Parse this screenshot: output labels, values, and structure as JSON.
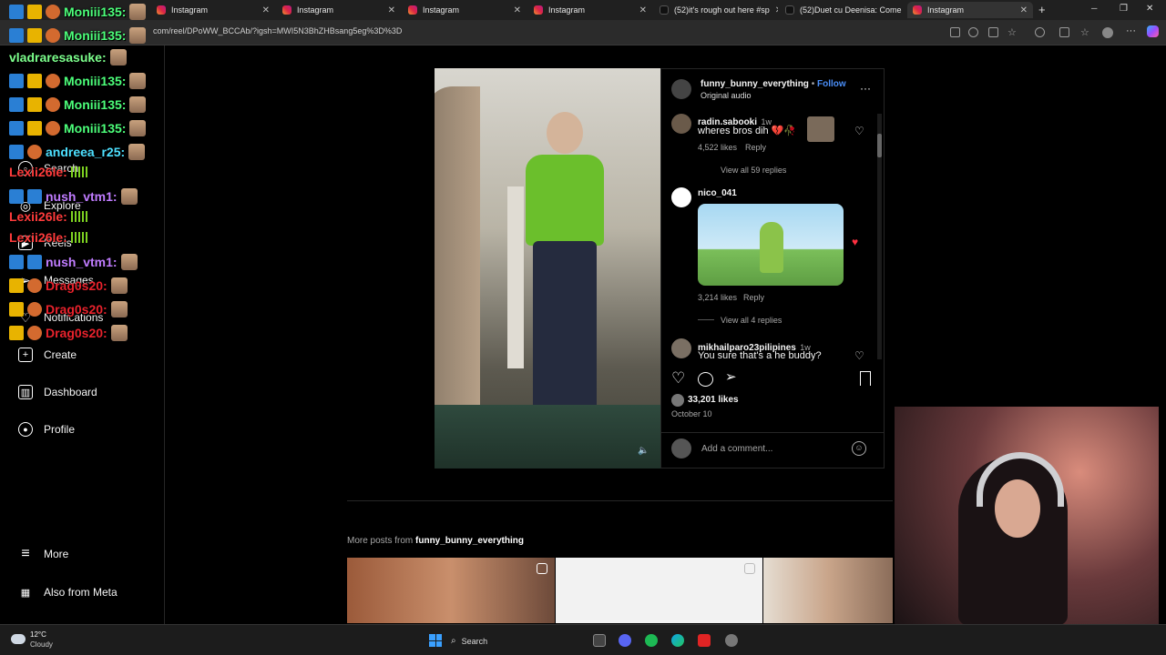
{
  "browser": {
    "tabs": [
      {
        "title": "Instagram",
        "icon": "instagram-icon"
      },
      {
        "title": "Instagram",
        "icon": "instagram-icon"
      },
      {
        "title": "Instagram",
        "icon": "instagram-icon"
      },
      {
        "title": "Instagram",
        "icon": "instagram-icon"
      },
      {
        "title": "(52)it's rough out here #sp",
        "icon": "tiktok-icon"
      },
      {
        "title": "(52)Duet cu Deenisa: Come",
        "icon": "tiktok-icon"
      },
      {
        "title": "Instagram",
        "icon": "instagram-icon"
      }
    ],
    "url": "com/reel/DPoWW_BCCAb/?igsh=MWI5N3BhZHBsang5eg%3D%3D",
    "new_tab": "+",
    "minimize": "─",
    "restore": "❐",
    "close": "✕"
  },
  "sidebar": {
    "items": [
      {
        "label": "Search",
        "icon": "search-icon"
      },
      {
        "label": "Explore",
        "icon": "compass-icon"
      },
      {
        "label": "Reels",
        "icon": "reels-icon"
      },
      {
        "label": "Messages",
        "icon": "messages-icon"
      },
      {
        "label": "Notifications",
        "icon": "heart-icon"
      },
      {
        "label": "Create",
        "icon": "plus-icon"
      },
      {
        "label": "Dashboard",
        "icon": "chart-icon"
      },
      {
        "label": "Profile",
        "icon": "profile-icon"
      }
    ],
    "more": "More",
    "meta": "Also from Meta"
  },
  "chat": [
    {
      "user": "Moniii135:",
      "color": "#4cff7a"
    },
    {
      "user": "Moniii135:",
      "color": "#4cff7a"
    },
    {
      "user": "vladraresasuke:",
      "color": "#7cff8c"
    },
    {
      "user": "Moniii135:",
      "color": "#4cff7a"
    },
    {
      "user": "Moniii135:",
      "color": "#4cff7a"
    },
    {
      "user": "Moniii135:",
      "color": "#4cff7a"
    },
    {
      "user": "andreea_r25:",
      "color": "#4de0ff"
    },
    {
      "user": "Lexii26le:",
      "color": "#ff3b3b"
    },
    {
      "user": "nush_vtm1:",
      "color": "#c07cff"
    },
    {
      "user": "Lexii26le:",
      "color": "#ff3b3b"
    },
    {
      "user": "Lexii26le:",
      "color": "#ff3b3b"
    },
    {
      "user": "nush_vtm1:",
      "color": "#c07cff"
    },
    {
      "user": "Drag0s20:",
      "color": "#e8222c"
    },
    {
      "user": "Drag0s20:",
      "color": "#e8222c"
    },
    {
      "user": "Drag0s20:",
      "color": "#e8222c"
    }
  ],
  "post": {
    "author": "funny_bunny_everything",
    "dot": "•",
    "follow": "Follow",
    "audio": "Original audio",
    "more": "···",
    "comments": [
      {
        "user": "radin.sabooki",
        "age": "1w",
        "text": "wheres bros dih 💔🥀",
        "likes": "4,522 likes",
        "reply": "Reply",
        "view": "View all 59 replies"
      },
      {
        "user": "nico_041",
        "age": "",
        "text": "",
        "likes": "3,214 likes",
        "reply": "Reply",
        "view": "View all 4 replies"
      },
      {
        "user": "mikhailparo23pilipines",
        "age": "1w",
        "text": "You sure that's a he buddy?"
      }
    ],
    "likes": "33,201 likes",
    "date": "October 10",
    "add_comment": "Add a comment..."
  },
  "more_posts": {
    "prefix": "More posts from",
    "author": "funny_bunny_everything"
  },
  "taskbar": {
    "weather_temp": "12°C",
    "weather_desc": "Cloudy",
    "search": "Search"
  }
}
